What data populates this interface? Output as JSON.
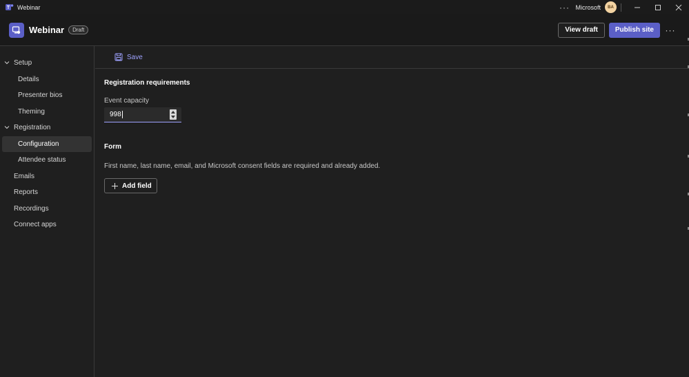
{
  "titlebar": {
    "app_title": "Webinar",
    "more_label": "···",
    "org_name": "Microsoft",
    "avatar_initials": "BA"
  },
  "header": {
    "title": "Webinar",
    "badge": "Draft",
    "view_draft_label": "View draft",
    "publish_label": "Publish site",
    "more_label": "···"
  },
  "sidebar": {
    "items": [
      {
        "label": "Setup"
      },
      {
        "label": "Details"
      },
      {
        "label": "Presenter bios"
      },
      {
        "label": "Theming"
      },
      {
        "label": "Registration"
      },
      {
        "label": "Configuration"
      },
      {
        "label": "Attendee status"
      },
      {
        "label": "Emails"
      },
      {
        "label": "Reports"
      },
      {
        "label": "Recordings"
      },
      {
        "label": "Connect apps"
      }
    ]
  },
  "toolbar": {
    "save_label": "Save"
  },
  "registration": {
    "title": "Registration requirements",
    "capacity_label": "Event capacity",
    "capacity_value": "998"
  },
  "form": {
    "title": "Form",
    "description": "First name, last name, email, and Microsoft consent fields are required and already added.",
    "add_field_label": "Add field"
  },
  "colors": {
    "accent": "#5b5fc7",
    "accent_text": "#9ea2ff",
    "background": "#1f1f1f"
  }
}
